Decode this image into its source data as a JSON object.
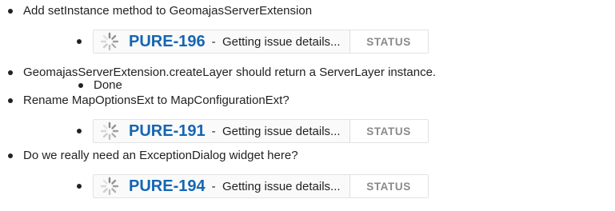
{
  "items": [
    {
      "text": "Add setInstance method to GeomajasServerExtension"
    },
    {
      "text": "GeomajasServerExtension.createLayer should return a ServerLayer instance."
    },
    {
      "text": "Done"
    },
    {
      "text": "Rename MapOptionsExt to MapConfigurationExt?"
    },
    {
      "text": "Do we really need an ExceptionDialog widget here?"
    }
  ],
  "jira": [
    {
      "key": "PURE-196",
      "separator": "-",
      "summary": "Getting issue details...",
      "status": "STATUS"
    },
    {
      "key": "PURE-191",
      "separator": "-",
      "summary": "Getting issue details...",
      "status": "STATUS"
    },
    {
      "key": "PURE-194",
      "separator": "-",
      "summary": "Getting issue details...",
      "status": "STATUS"
    }
  ],
  "colors": {
    "link": "#1466b3",
    "text": "#222222",
    "status_text": "#8a8a8a",
    "spinner": "#888888"
  },
  "icons": {
    "loading": "loading-spinner-icon",
    "bullet": "bullet-icon"
  }
}
